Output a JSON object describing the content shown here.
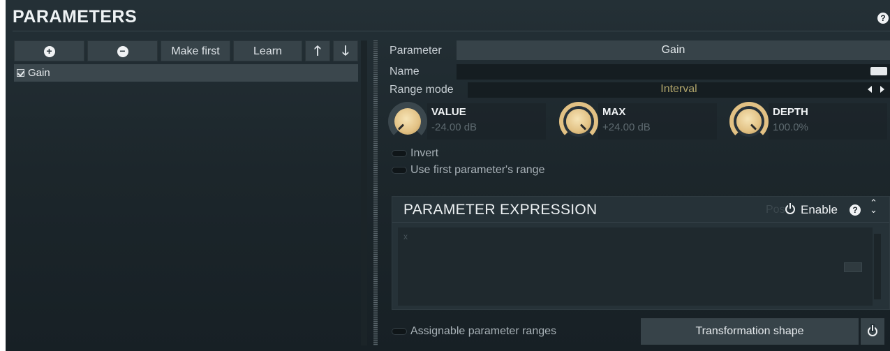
{
  "panel": {
    "title": "PARAMETERS",
    "help_icon": "?"
  },
  "toolbar": {
    "add_icon": "+",
    "remove_icon": "−",
    "make_first_label": "Make first",
    "learn_label": "Learn",
    "up_icon": "🡑",
    "down_icon": "🡓"
  },
  "parameters_list": [
    {
      "label": "Gain",
      "checked": true
    }
  ],
  "right": {
    "parameter_label": "Parameter",
    "parameter_value": "Gain",
    "name_label": "Name",
    "name_value": "",
    "range_mode_label": "Range mode",
    "range_mode_value": "Interval",
    "knobs": [
      {
        "name": "VALUE",
        "value": "-24.00 dB"
      },
      {
        "name": "MAX",
        "value": "+24.00 dB"
      },
      {
        "name": "DEPTH",
        "value": "100.0%"
      }
    ],
    "invert_label": "Invert",
    "use_first_range_label": "Use first parameter's range"
  },
  "expression": {
    "title": "PARAMETER EXPRESSION",
    "post_label": "Post",
    "enable_label": "Enable",
    "help_icon": "?",
    "updown_icon": "⌃⌄",
    "placeholder": "x"
  },
  "bottom": {
    "assignable_ranges_label": "Assignable parameter ranges",
    "transformation_shape_label": "Transformation shape"
  },
  "colors": {
    "accent": "#e2c184",
    "background": "#1f2a30",
    "button": "#374349"
  }
}
